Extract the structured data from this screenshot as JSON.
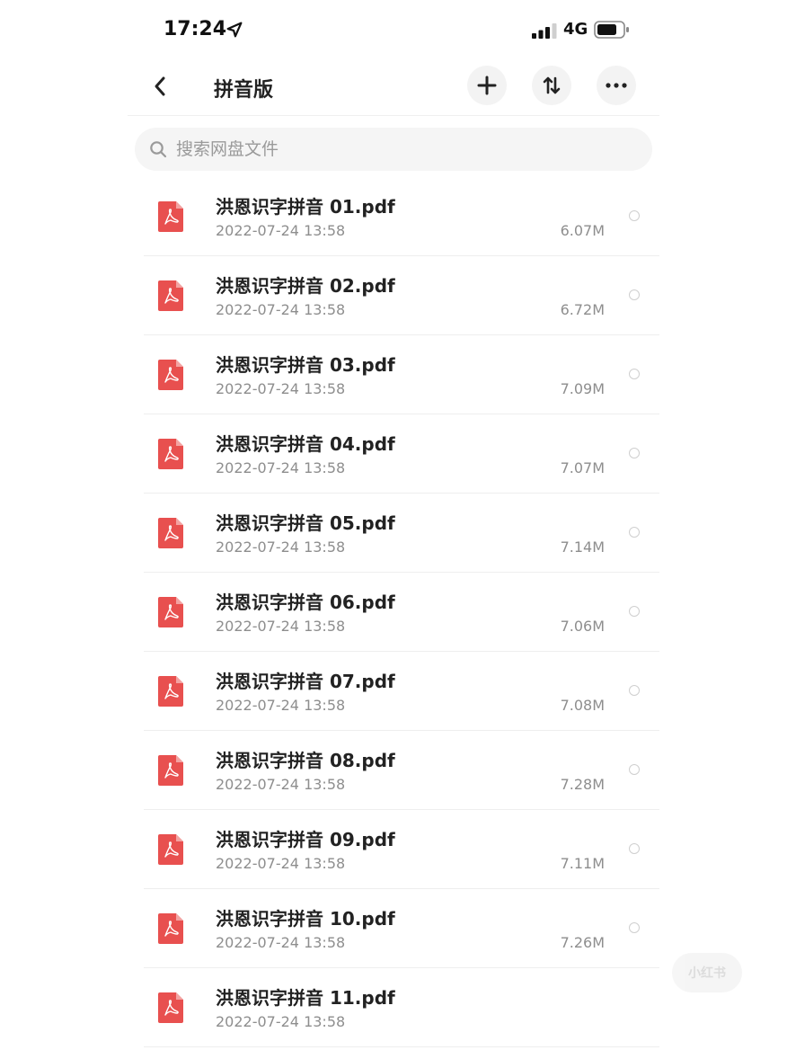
{
  "status_bar": {
    "time": "17:24",
    "network": "4G",
    "icons": [
      "location-arrow-icon",
      "signal-icon",
      "battery-icon"
    ]
  },
  "nav": {
    "title": "拼音版",
    "icons": [
      "back-chevron-icon",
      "plus-icon",
      "sort-arrows-icon",
      "more-dots-icon"
    ]
  },
  "search": {
    "placeholder": "搜索网盘文件"
  },
  "files": [
    {
      "name": "洪恩识字拼音 01.pdf",
      "date": "2022-07-24 13:58",
      "size": "6.07M"
    },
    {
      "name": "洪恩识字拼音 02.pdf",
      "date": "2022-07-24 13:58",
      "size": "6.72M"
    },
    {
      "name": "洪恩识字拼音 03.pdf",
      "date": "2022-07-24 13:58",
      "size": "7.09M"
    },
    {
      "name": "洪恩识字拼音 04.pdf",
      "date": "2022-07-24 13:58",
      "size": "7.07M"
    },
    {
      "name": "洪恩识字拼音 05.pdf",
      "date": "2022-07-24 13:58",
      "size": "7.14M"
    },
    {
      "name": "洪恩识字拼音 06.pdf",
      "date": "2022-07-24 13:58",
      "size": "7.06M"
    },
    {
      "name": "洪恩识字拼音 07.pdf",
      "date": "2022-07-24 13:58",
      "size": "7.08M"
    },
    {
      "name": "洪恩识字拼音 08.pdf",
      "date": "2022-07-24 13:58",
      "size": "7.28M"
    },
    {
      "name": "洪恩识字拼音 09.pdf",
      "date": "2022-07-24 13:58",
      "size": "7.11M"
    },
    {
      "name": "洪恩识字拼音 10.pdf",
      "date": "2022-07-24 13:58",
      "size": "7.26M"
    },
    {
      "name": "洪恩识字拼音 11.pdf",
      "date": "2022-07-24 13:58",
      "size": ""
    }
  ],
  "colors": {
    "pdf_icon": "#e8504f",
    "text_primary": "#222222",
    "text_secondary": "#8e8e8e",
    "divider": "#eeeeee"
  },
  "watermark": {
    "label": "小红书"
  }
}
